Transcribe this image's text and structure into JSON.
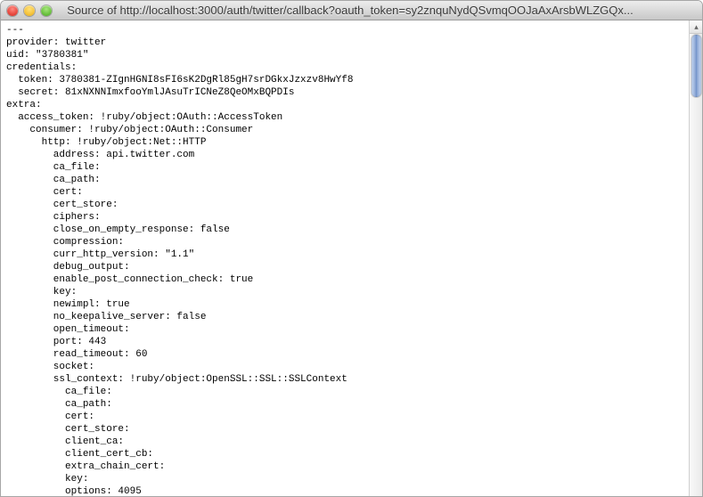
{
  "window": {
    "title": "Source of http://localhost:3000/auth/twitter/callback?oauth_token=sy2znquNydQSvmqOOJaAxArsbWLZGQx..."
  },
  "source": {
    "lines": [
      "---",
      "provider: twitter",
      "uid: \"3780381\"",
      "credentials:",
      "  token: 3780381-ZIgnHGNI8sFI6sK2DgRl85gH7srDGkxJzxzv8HwYf8",
      "  secret: 81xNXNNImxfooYmlJAsuTrICNeZ8QeOMxBQPDIs",
      "extra:",
      "  access_token: !ruby/object:OAuth::AccessToken",
      "    consumer: !ruby/object:OAuth::Consumer",
      "      http: !ruby/object:Net::HTTP",
      "        address: api.twitter.com",
      "        ca_file:",
      "        ca_path:",
      "        cert:",
      "        cert_store:",
      "        ciphers:",
      "        close_on_empty_response: false",
      "        compression:",
      "        curr_http_version: \"1.1\"",
      "        debug_output:",
      "        enable_post_connection_check: true",
      "        key:",
      "        newimpl: true",
      "        no_keepalive_server: false",
      "        open_timeout:",
      "        port: 443",
      "        read_timeout: 60",
      "        socket:",
      "        ssl_context: !ruby/object:OpenSSL::SSL::SSLContext",
      "          ca_file:",
      "          ca_path:",
      "          cert:",
      "          cert_store:",
      "          client_ca:",
      "          client_cert_cb:",
      "          extra_chain_cert:",
      "          key:",
      "          options: 4095"
    ]
  }
}
